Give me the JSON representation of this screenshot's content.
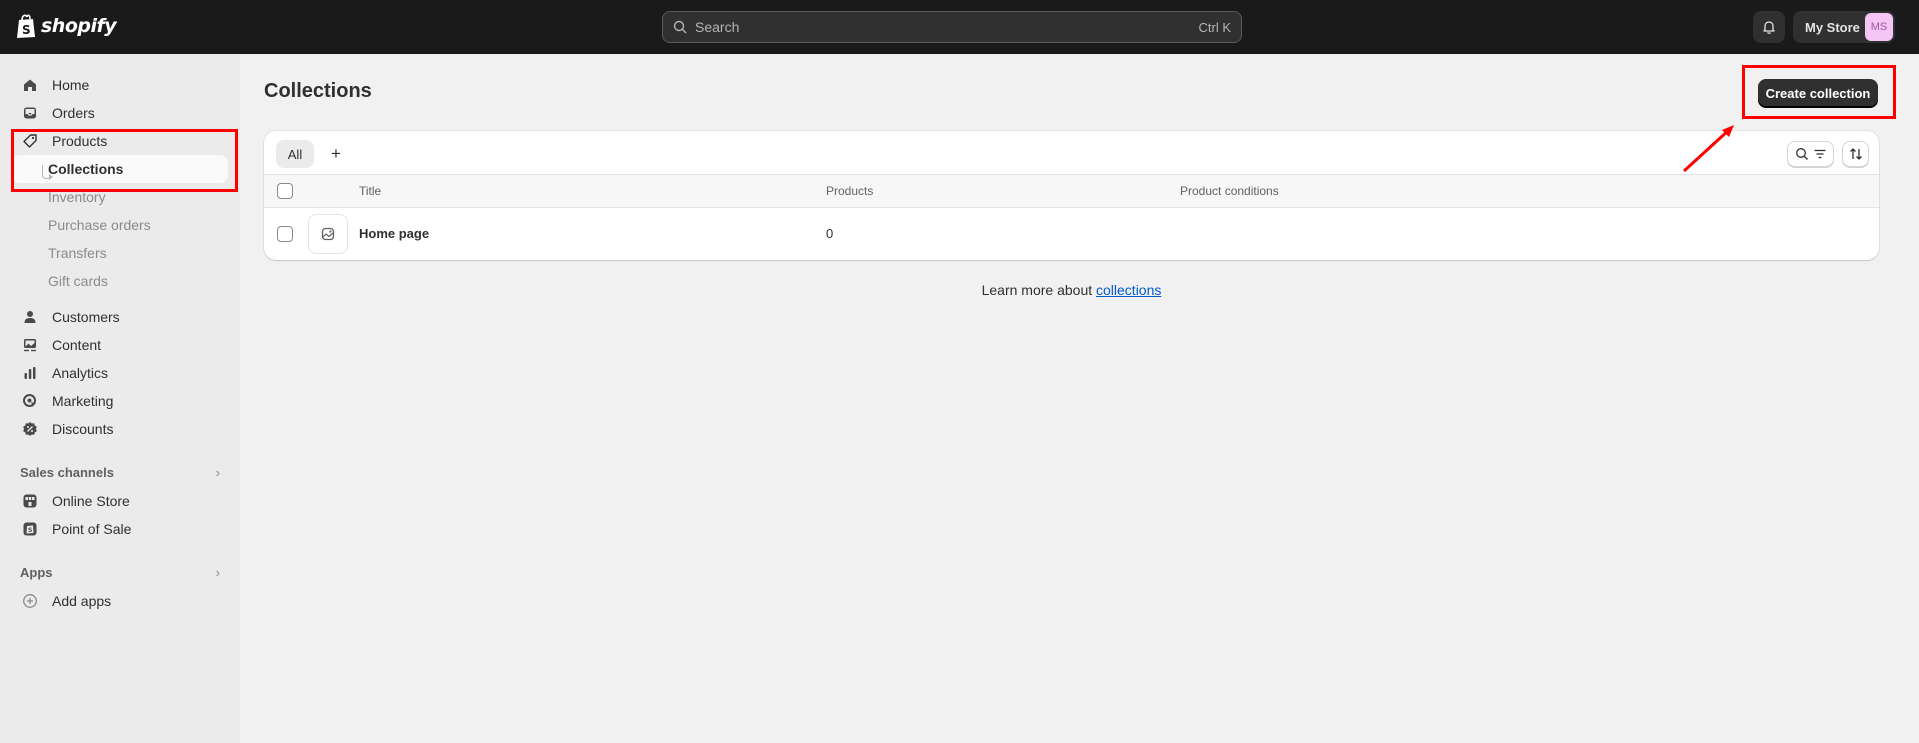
{
  "topbar": {
    "logo_text": "shopify",
    "search_placeholder": "Search",
    "search_shortcut": "Ctrl K",
    "store_name": "My Store",
    "avatar_initials": "MS"
  },
  "sidebar": {
    "items": [
      {
        "label": "Home",
        "icon": "home-icon"
      },
      {
        "label": "Orders",
        "icon": "inbox-icon"
      },
      {
        "label": "Products",
        "icon": "tag-icon"
      },
      {
        "label": "Collections",
        "active": true
      },
      {
        "label": "Inventory"
      },
      {
        "label": "Purchase orders"
      },
      {
        "label": "Transfers"
      },
      {
        "label": "Gift cards"
      },
      {
        "label": "Customers",
        "icon": "person-icon"
      },
      {
        "label": "Content",
        "icon": "content-icon"
      },
      {
        "label": "Analytics",
        "icon": "bar-chart-icon"
      },
      {
        "label": "Marketing",
        "icon": "target-icon"
      },
      {
        "label": "Discounts",
        "icon": "discount-icon"
      }
    ],
    "sales_channels": {
      "label": "Sales channels",
      "items": [
        {
          "label": "Online Store",
          "icon": "store-icon"
        },
        {
          "label": "Point of Sale",
          "icon": "pos-icon"
        }
      ]
    },
    "apps": {
      "label": "Apps",
      "items": [
        {
          "label": "Add apps",
          "icon": "plus-circle-icon"
        }
      ]
    }
  },
  "main": {
    "title": "Collections",
    "create_button": "Create collection",
    "tabs": [
      {
        "label": "All",
        "selected": true
      },
      {
        "label": "+"
      }
    ],
    "table": {
      "columns": [
        "Title",
        "Products",
        "Product conditions"
      ],
      "rows": [
        {
          "title": "Home page",
          "products": "0",
          "conditions": ""
        }
      ]
    },
    "learn_more": {
      "text": "Learn more about ",
      "link": "collections"
    }
  },
  "annotations": {
    "color": "#ff0000"
  }
}
